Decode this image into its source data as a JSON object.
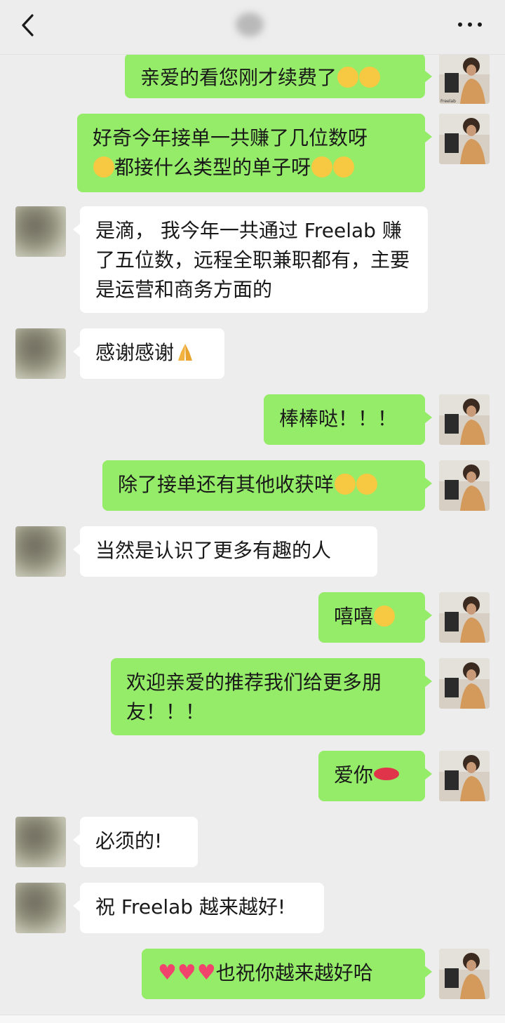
{
  "header": {
    "back_icon": "chevron-left-icon",
    "more_icon": "more-dots-icon"
  },
  "messages": [
    {
      "side": "right",
      "text": "亲爱的看您刚才续费了",
      "emojis": [
        "thinking-face",
        "thinking-face"
      ]
    },
    {
      "side": "right",
      "text": "好奇今年接单一共赚了几位数呀",
      "text2": "都接什么类型的单子呀",
      "emojis_mid": [
        "heart-eyes-face"
      ],
      "emojis": [
        "confused-face",
        "confused-face"
      ]
    },
    {
      "side": "left",
      "text": "是滴， 我今年一共通过 Freelab 赚了五位数，远程全职兼职都有，主要是运营和商务方面的"
    },
    {
      "side": "left",
      "text": "感谢感谢",
      "emojis": [
        "folded-hands"
      ]
    },
    {
      "side": "right",
      "text": "棒棒哒！！！"
    },
    {
      "side": "right",
      "text": "除了接单还有其他收获咩",
      "emojis": [
        "thinking-face",
        "thinking-face"
      ]
    },
    {
      "side": "left",
      "text": "当然是认识了更多有趣的人"
    },
    {
      "side": "right",
      "text": "嘻嘻",
      "emojis": [
        "smiling-face"
      ]
    },
    {
      "side": "right",
      "text": "欢迎亲爱的推荐我们给更多朋友！！！"
    },
    {
      "side": "right",
      "text": "爱你",
      "emojis": [
        "lips"
      ]
    },
    {
      "side": "left",
      "text": "必须的!"
    },
    {
      "side": "left",
      "text": "祝 Freelab 越来越好!"
    },
    {
      "side": "right",
      "text": "也祝你越来越好哈",
      "emojis_lead": [
        "heart",
        "heart",
        "heart"
      ]
    }
  ],
  "avatar_caption": "Freelab Freelab Freelab",
  "colors": {
    "bg": "#ededed",
    "outgoing_bubble": "#95ec69",
    "incoming_bubble": "#ffffff",
    "text": "#191919"
  }
}
